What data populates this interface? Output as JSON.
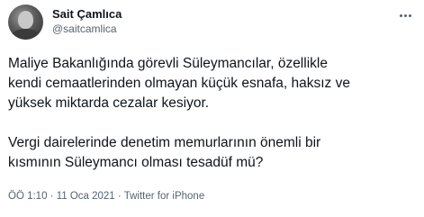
{
  "author": {
    "display_name": "Sait Çamlıca",
    "handle": "@saitcamlica"
  },
  "tweet": {
    "paragraph_1": "Maliye Bakanlığında görevli Süleymancılar, özellikle\nkendi cemaatlerinden olmayan küçük esnafa, haksız ve\nyüksek miktarda cezalar kesiyor.",
    "paragraph_2": "Vergi dairelerinde denetim memurlarının önemli bir\nkısmının Süleymancı olması tesadüf mü?"
  },
  "meta": {
    "time": "ÖÖ 1:10",
    "separator_1": " · ",
    "date": "11 Oca 2021",
    "separator_2": " · ",
    "source": "Twitter for iPhone"
  },
  "icons": {
    "avatar": "user-avatar-photo",
    "more": "more-horizontal-icon"
  },
  "colors": {
    "text_primary": "#0f1419",
    "text_secondary": "#536471",
    "background": "#ffffff"
  }
}
